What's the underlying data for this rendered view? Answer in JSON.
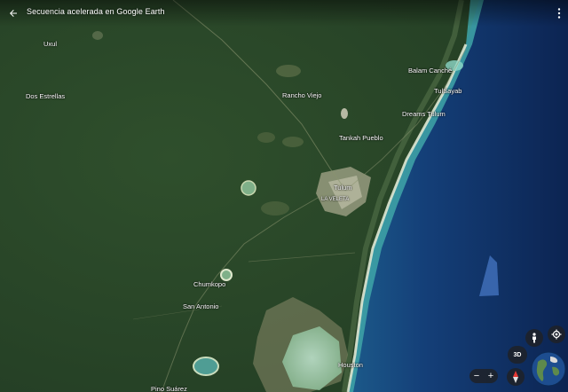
{
  "header": {
    "title": "Secuencia acelerada en Google Earth"
  },
  "places": [
    {
      "id": "uxul",
      "label": "Uxul"
    },
    {
      "id": "dos-estrellas",
      "label": "Dos Estrellas"
    },
    {
      "id": "rancho-viejo",
      "label": "Rancho Viejo"
    },
    {
      "id": "balam-canche",
      "label": "Balam Canché"
    },
    {
      "id": "tulsayab",
      "label": "TulSayab"
    },
    {
      "id": "dreams-tulum",
      "label": "Dreams Tulum"
    },
    {
      "id": "tankah-pueblo",
      "label": "Tankah Pueblo"
    },
    {
      "id": "tulum",
      "label": "Tulum"
    },
    {
      "id": "la-veleta",
      "label": "LA VELETA"
    },
    {
      "id": "chumkopo",
      "label": "Chumkopo"
    },
    {
      "id": "san-antonio",
      "label": "San Antonio"
    },
    {
      "id": "houston",
      "label": "Houston"
    },
    {
      "id": "cut-bottom",
      "label": "Pino Suárez"
    }
  ],
  "controls": {
    "btn_3d_label": "3D",
    "zoom_out_label": "−",
    "zoom_in_label": "+"
  },
  "icons": {
    "back": "arrow-left-icon",
    "menu": "more-vert-icon",
    "pegman": "street-view-icon",
    "location": "my-location-icon",
    "compass": "compass-icon",
    "globe": "globe-icon"
  },
  "colors": {
    "jungle": "#2c4a2a",
    "coast_sand": "#d8e0c8",
    "shallow_water": "#3fa6a8",
    "deep_ocean": "#0f2a5c",
    "control_bg": "#202124"
  }
}
